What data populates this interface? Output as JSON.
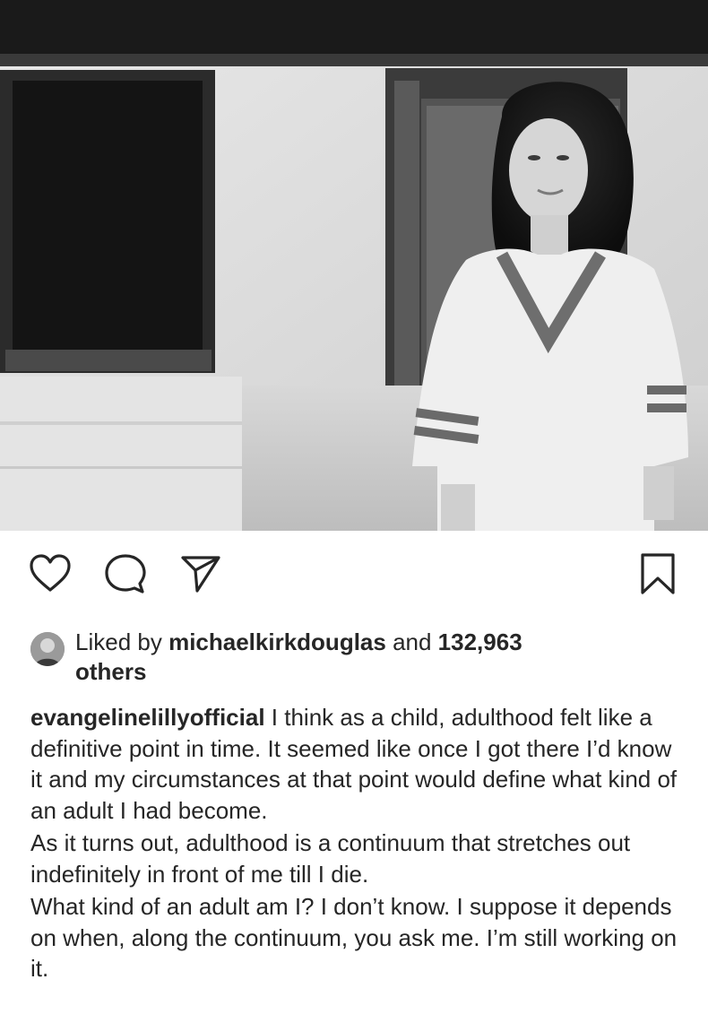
{
  "post": {
    "photo": {
      "description_icon": "post-photo"
    },
    "actions": {
      "like_icon": "heart-icon",
      "comment_icon": "comment-icon",
      "share_icon": "paper-plane-icon",
      "save_icon": "bookmark-icon"
    },
    "likes": {
      "prefix": "Liked by ",
      "liker": "michaelkirkdouglas",
      "middle": " and ",
      "count": "132,963",
      "suffix": "others"
    },
    "caption": {
      "username": "evangelinelillyofficial",
      "paragraph1": "I think as a child, adulthood felt like a definitive point in time.  It seemed like once I got there I’d know it and my circumstances at that point would define what kind of an adult I had become.",
      "paragraph2": "As it turns out, adulthood is a continuum that stretches out indefinitely in front of me till I die.",
      "paragraph3": "What kind of an adult am I?  I don’t know.  I suppose it depends on when, along the continuum, you ask me.  I’m still working on it."
    }
  },
  "colors": {
    "text": "#262626",
    "background": "#ffffff"
  }
}
